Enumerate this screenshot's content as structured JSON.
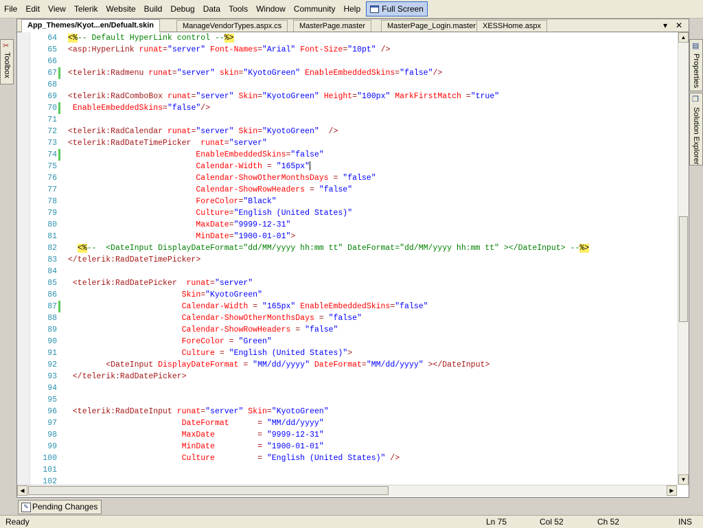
{
  "menu": {
    "items": [
      "File",
      "Edit",
      "View",
      "Telerik",
      "Website",
      "Build",
      "Debug",
      "Data",
      "Tools",
      "Window",
      "Community",
      "Help"
    ],
    "fullscreen_label": "Full Screen"
  },
  "left_panel": {
    "toolbox_label": "Toolbox"
  },
  "right_panel": {
    "properties_label": "Properties",
    "solution_explorer_label": "Solution Explorer"
  },
  "tabs": [
    {
      "label": "App_Themes/Kyot...en/Defualt.skin",
      "active": true
    },
    {
      "label": "ManageVendorTypes.aspx.cs",
      "active": false
    },
    {
      "label": "MasterPage.master",
      "active": false
    },
    {
      "label": "MasterPage_Login.master",
      "active": false
    },
    {
      "label": "XESSHome.aspx",
      "active": false
    }
  ],
  "tab_controls": {
    "dropdown": "▾",
    "close": "✕"
  },
  "code_lines": [
    {
      "n": "64",
      "c": false,
      "segs": [
        [
          "d",
          "<%"
        ],
        [
          "k",
          "-- Default HyperLink control --"
        ],
        [
          "d",
          "%>"
        ]
      ]
    },
    {
      "n": "65",
      "c": false,
      "segs": [
        [
          "t",
          "<asp:HyperLink "
        ],
        [
          "a",
          "runat"
        ],
        [
          "t",
          "="
        ],
        [
          "v",
          "\"server\""
        ],
        [
          "t",
          " "
        ],
        [
          "a",
          "Font-Names"
        ],
        [
          "t",
          "="
        ],
        [
          "v",
          "\"Arial\""
        ],
        [
          "t",
          " "
        ],
        [
          "a",
          "Font-Size"
        ],
        [
          "t",
          "="
        ],
        [
          "v",
          "\"10pt\""
        ],
        [
          "t",
          " />"
        ]
      ]
    },
    {
      "n": "66",
      "c": false,
      "segs": []
    },
    {
      "n": "67",
      "c": true,
      "segs": [
        [
          "t",
          "<telerik:Radmenu "
        ],
        [
          "a",
          "runat"
        ],
        [
          "t",
          "="
        ],
        [
          "v",
          "\"server\""
        ],
        [
          "t",
          " "
        ],
        [
          "a",
          "skin"
        ],
        [
          "t",
          "="
        ],
        [
          "v",
          "\"KyotoGreen\""
        ],
        [
          "t",
          " "
        ],
        [
          "a",
          "EnableEmbeddedSkins"
        ],
        [
          "t",
          "="
        ],
        [
          "v",
          "\"false\""
        ],
        [
          "t",
          "/>"
        ]
      ]
    },
    {
      "n": "68",
      "c": false,
      "segs": []
    },
    {
      "n": "69",
      "c": false,
      "segs": [
        [
          "t",
          "<telerik:RadComboBox "
        ],
        [
          "a",
          "runat"
        ],
        [
          "t",
          "="
        ],
        [
          "v",
          "\"server\""
        ],
        [
          "t",
          " "
        ],
        [
          "a",
          "Skin"
        ],
        [
          "t",
          "="
        ],
        [
          "v",
          "\"KyotoGreen\""
        ],
        [
          "t",
          " "
        ],
        [
          "a",
          "Height"
        ],
        [
          "t",
          "="
        ],
        [
          "v",
          "\"100px\""
        ],
        [
          "t",
          " "
        ],
        [
          "a",
          "MarkFirstMatch"
        ],
        [
          "t",
          " ="
        ],
        [
          "v",
          "\"true\""
        ]
      ]
    },
    {
      "n": "70",
      "c": true,
      "segs": [
        [
          "t",
          " "
        ],
        [
          "a",
          "EnableEmbeddedSkins"
        ],
        [
          "t",
          "="
        ],
        [
          "v",
          "\"false\""
        ],
        [
          "t",
          "/>"
        ]
      ]
    },
    {
      "n": "71",
      "c": false,
      "segs": []
    },
    {
      "n": "72",
      "c": false,
      "segs": [
        [
          "t",
          "<telerik:RadCalendar "
        ],
        [
          "a",
          "runat"
        ],
        [
          "t",
          "="
        ],
        [
          "v",
          "\"server\""
        ],
        [
          "t",
          " "
        ],
        [
          "a",
          "Skin"
        ],
        [
          "t",
          "="
        ],
        [
          "v",
          "\"KyotoGreen\""
        ],
        [
          "t",
          "  />"
        ]
      ]
    },
    {
      "n": "73",
      "c": false,
      "segs": [
        [
          "t",
          "<telerik:RadDateTimePicker  "
        ],
        [
          "a",
          "runat"
        ],
        [
          "t",
          "="
        ],
        [
          "v",
          "\"server\""
        ]
      ]
    },
    {
      "n": "74",
      "c": true,
      "segs": [
        [
          "t",
          "                           "
        ],
        [
          "a",
          "EnableEmbeddedSkins"
        ],
        [
          "t",
          "="
        ],
        [
          "v",
          "\"false\""
        ]
      ]
    },
    {
      "n": "75",
      "c": false,
      "caret": true,
      "segs": [
        [
          "t",
          "                           "
        ],
        [
          "a",
          "Calendar-Width"
        ],
        [
          "t",
          " = "
        ],
        [
          "v",
          "\"165px\""
        ]
      ]
    },
    {
      "n": "76",
      "c": false,
      "segs": [
        [
          "t",
          "                           "
        ],
        [
          "a",
          "Calendar-ShowOtherMonthsDays"
        ],
        [
          "t",
          " = "
        ],
        [
          "v",
          "\"false\""
        ]
      ]
    },
    {
      "n": "77",
      "c": false,
      "segs": [
        [
          "t",
          "                           "
        ],
        [
          "a",
          "Calendar-ShowRowHeaders"
        ],
        [
          "t",
          " = "
        ],
        [
          "v",
          "\"false\""
        ]
      ]
    },
    {
      "n": "78",
      "c": false,
      "segs": [
        [
          "t",
          "                           "
        ],
        [
          "a",
          "ForeColor"
        ],
        [
          "t",
          "="
        ],
        [
          "v",
          "\"Black\""
        ]
      ]
    },
    {
      "n": "79",
      "c": false,
      "segs": [
        [
          "t",
          "                           "
        ],
        [
          "a",
          "Culture"
        ],
        [
          "t",
          "="
        ],
        [
          "v",
          "\"English (United States)\""
        ]
      ]
    },
    {
      "n": "80",
      "c": false,
      "segs": [
        [
          "t",
          "                           "
        ],
        [
          "a",
          "MaxDate"
        ],
        [
          "t",
          "="
        ],
        [
          "v",
          "\"9999-12-31\""
        ]
      ]
    },
    {
      "n": "81",
      "c": false,
      "segs": [
        [
          "t",
          "                           "
        ],
        [
          "a",
          "MinDate"
        ],
        [
          "t",
          "="
        ],
        [
          "v",
          "\"1900-01-01\""
        ],
        [
          "t",
          ">"
        ]
      ]
    },
    {
      "n": "82",
      "c": false,
      "segs": [
        [
          "t",
          "  "
        ],
        [
          "d",
          "<%"
        ],
        [
          "k",
          "--  <DateInput DisplayDateFormat=\"dd/MM/yyyy hh:mm tt\" DateFormat=\"dd/MM/yyyy hh:mm tt\" ></DateInput> --"
        ],
        [
          "d",
          "%>"
        ]
      ]
    },
    {
      "n": "83",
      "c": false,
      "segs": [
        [
          "t",
          "</telerik:RadDateTimePicker>"
        ]
      ]
    },
    {
      "n": "84",
      "c": false,
      "segs": []
    },
    {
      "n": "85",
      "c": false,
      "segs": [
        [
          "t",
          " <telerik:RadDatePicker  "
        ],
        [
          "a",
          "runat"
        ],
        [
          "t",
          "="
        ],
        [
          "v",
          "\"server\""
        ]
      ]
    },
    {
      "n": "86",
      "c": false,
      "segs": [
        [
          "t",
          "                        "
        ],
        [
          "a",
          "Skin"
        ],
        [
          "t",
          "="
        ],
        [
          "v",
          "\"KyotoGreen\""
        ]
      ]
    },
    {
      "n": "87",
      "c": true,
      "segs": [
        [
          "t",
          "                        "
        ],
        [
          "a",
          "Calendar-Width"
        ],
        [
          "t",
          " = "
        ],
        [
          "v",
          "\"165px\""
        ],
        [
          "t",
          " "
        ],
        [
          "a",
          "EnableEmbeddedSkins"
        ],
        [
          "t",
          "="
        ],
        [
          "v",
          "\"false\""
        ]
      ]
    },
    {
      "n": "88",
      "c": false,
      "segs": [
        [
          "t",
          "                        "
        ],
        [
          "a",
          "Calendar-ShowOtherMonthsDays"
        ],
        [
          "t",
          " = "
        ],
        [
          "v",
          "\"false\""
        ]
      ]
    },
    {
      "n": "89",
      "c": false,
      "segs": [
        [
          "t",
          "                        "
        ],
        [
          "a",
          "Calendar-ShowRowHeaders"
        ],
        [
          "t",
          " = "
        ],
        [
          "v",
          "\"false\""
        ]
      ]
    },
    {
      "n": "90",
      "c": false,
      "segs": [
        [
          "t",
          "                        "
        ],
        [
          "a",
          "ForeColor"
        ],
        [
          "t",
          " = "
        ],
        [
          "v",
          "\"Green\""
        ]
      ]
    },
    {
      "n": "91",
      "c": false,
      "segs": [
        [
          "t",
          "                        "
        ],
        [
          "a",
          "Culture"
        ],
        [
          "t",
          " = "
        ],
        [
          "v",
          "\"English (United States)\""
        ],
        [
          "t",
          ">"
        ]
      ]
    },
    {
      "n": "92",
      "c": false,
      "segs": [
        [
          "t",
          "        <DateInput "
        ],
        [
          "a",
          "DisplayDateFormat"
        ],
        [
          "t",
          " = "
        ],
        [
          "v",
          "\"MM/dd/yyyy\""
        ],
        [
          "t",
          " "
        ],
        [
          "a",
          "DateFormat"
        ],
        [
          "t",
          "="
        ],
        [
          "v",
          "\"MM/dd/yyyy\""
        ],
        [
          "t",
          " ></DateInput>"
        ]
      ]
    },
    {
      "n": "93",
      "c": false,
      "segs": [
        [
          "t",
          " </telerik:RadDatePicker>"
        ]
      ]
    },
    {
      "n": "94",
      "c": false,
      "segs": []
    },
    {
      "n": "95",
      "c": false,
      "segs": []
    },
    {
      "n": "96",
      "c": false,
      "segs": [
        [
          "t",
          " <telerik:RadDateInput "
        ],
        [
          "a",
          "runat"
        ],
        [
          "t",
          "="
        ],
        [
          "v",
          "\"server\""
        ],
        [
          "t",
          " "
        ],
        [
          "a",
          "Skin"
        ],
        [
          "t",
          "="
        ],
        [
          "v",
          "\"KyotoGreen\""
        ]
      ]
    },
    {
      "n": "97",
      "c": false,
      "segs": [
        [
          "t",
          "                        "
        ],
        [
          "a",
          "DateFormat"
        ],
        [
          "t",
          "      = "
        ],
        [
          "v",
          "\"MM/dd/yyyy\""
        ]
      ]
    },
    {
      "n": "98",
      "c": false,
      "segs": [
        [
          "t",
          "                        "
        ],
        [
          "a",
          "MaxDate"
        ],
        [
          "t",
          "         = "
        ],
        [
          "v",
          "\"9999-12-31\""
        ]
      ]
    },
    {
      "n": "99",
      "c": false,
      "segs": [
        [
          "t",
          "                        "
        ],
        [
          "a",
          "MinDate"
        ],
        [
          "t",
          "         = "
        ],
        [
          "v",
          "\"1900-01-01\""
        ]
      ]
    },
    {
      "n": "100",
      "c": false,
      "segs": [
        [
          "t",
          "                        "
        ],
        [
          "a",
          "Culture"
        ],
        [
          "t",
          "         = "
        ],
        [
          "v",
          "\"English (United States)\""
        ],
        [
          "t",
          " />"
        ]
      ]
    },
    {
      "n": "101",
      "c": false,
      "segs": []
    },
    {
      "n": "102",
      "c": false,
      "segs": []
    }
  ],
  "bottom_panel": {
    "pending_changes_label": "Pending Changes"
  },
  "status": {
    "ready": "Ready",
    "ln": "Ln 75",
    "col": "Col 52",
    "ch": "Ch 52",
    "ins": "INS"
  }
}
